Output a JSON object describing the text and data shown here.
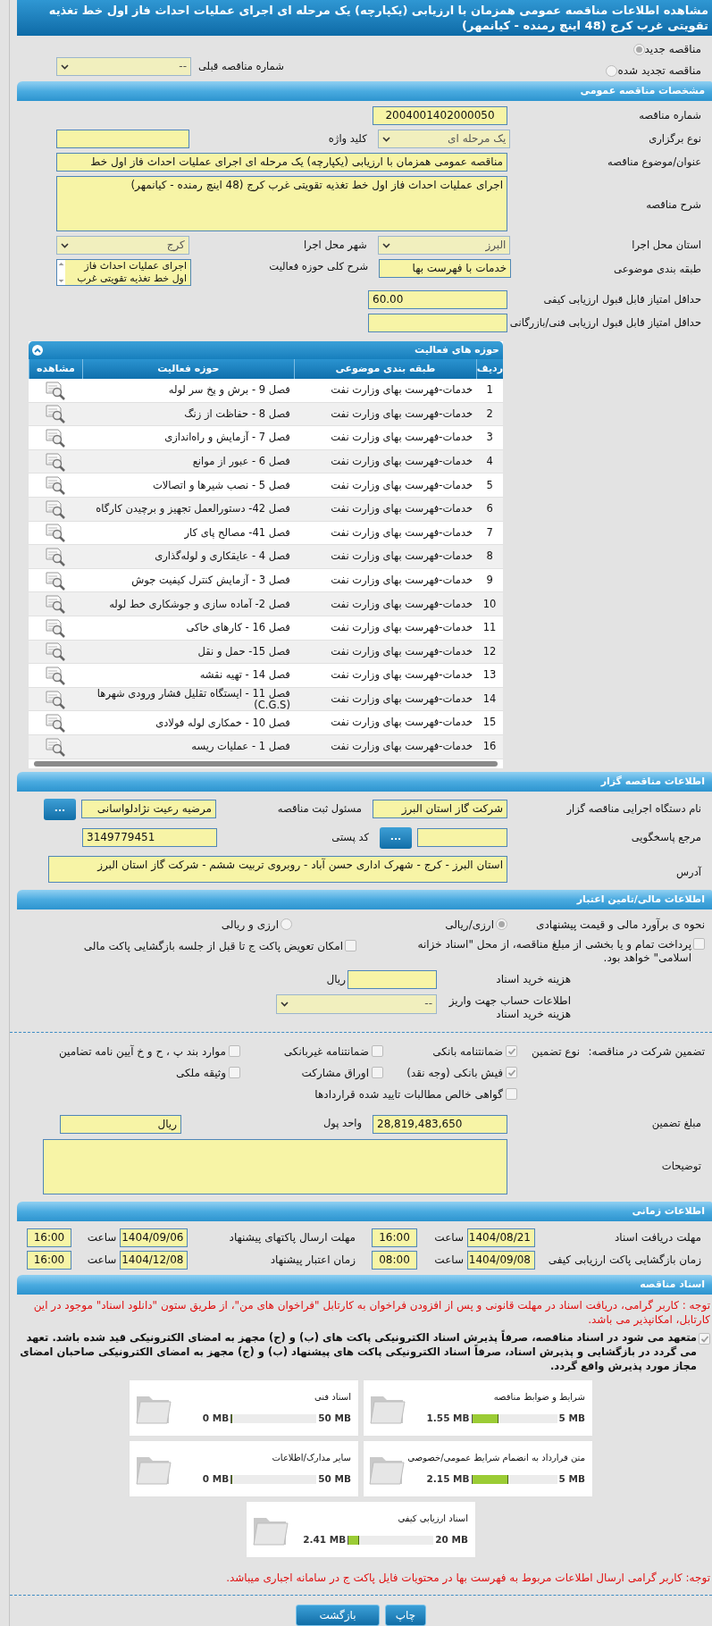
{
  "title": "مشاهده اطلاعات مناقصه عمومی همزمان با ارزیابی (یکپارچه) یک مرحله ای اجرای عملیات احداث فاز اول خط تغذیه تقویتی غرب کرج (48 اینچ رمنده - کیانمهر)",
  "tender_options": [
    {
      "label": "مناقصه جدید",
      "selected": true
    },
    {
      "label": "مناقصه تجدید شده",
      "selected": false
    }
  ],
  "previous_tender": {
    "label": "شماره مناقصه قبلی",
    "value": "--"
  },
  "general": {
    "header": "مشخصات مناقصه عمومی",
    "number": {
      "label": "شماره مناقصه",
      "value": "2004001402000050"
    },
    "holding_type": {
      "label": "نوع برگزاری",
      "value": "یک مرحله ای"
    },
    "keyword": {
      "label": "کلید واژه"
    },
    "subject": {
      "label": "عنوان/موضوع مناقصه",
      "value": "مناقصه عمومی همزمان با ارزیابی (یکپارچه) یک مرحله ای اجرای عملیات احداث فاز اول خط"
    },
    "description": {
      "label": "شرح مناقصه",
      "value": "اجرای عملیات احداث فاز اول خط تغذیه تقویتی غرب کرج (48 اینچ رمنده - کیانمهر)"
    },
    "province": {
      "label": "استان محل اجرا",
      "value": "البرز"
    },
    "city": {
      "label": "شهر محل اجرا",
      "value": "کرج"
    },
    "category": {
      "label": "طبقه بندی موضوعی",
      "value": "خدمات با فهرست بها"
    },
    "activity_summary": {
      "label": "شرح کلی حوزه فعالیت",
      "value": "اجرای عملیات احداث فاز اول خط تغذیه تقویتی غرب"
    },
    "min_quality": {
      "label": "حداقل امتیاز قابل قبول ارزیابی کیفی",
      "value": "60.00"
    },
    "min_technical": {
      "label": "حداقل امتیاز قابل قبول ارزیابی فنی/بازرگانی"
    }
  },
  "activities": {
    "header": "حوزه های فعالیت",
    "columns": [
      "ردیف",
      "طبقه بندی موضوعی",
      "حوزه فعالیت",
      "مشاهده"
    ],
    "rows": [
      [
        "1",
        "خدمات-فهرست بهای وزارت نفت",
        "فصل 9 - برش و پخ سر لوله"
      ],
      [
        "2",
        "خدمات-فهرست بهای وزارت نفت",
        "فصل 8 - حفاظت از زنگ"
      ],
      [
        "3",
        "خدمات-فهرست بهای وزارت نفت",
        "فصل 7 - آزمایش و راه‌اندازی"
      ],
      [
        "4",
        "خدمات-فهرست بهای وزارت نفت",
        "فصل 6 - عبور از موانع"
      ],
      [
        "5",
        "خدمات-فهرست بهای وزارت نفت",
        "فصل 5 - نصب شیرها و اتصالات"
      ],
      [
        "6",
        "خدمات-فهرست بهای وزارت نفت",
        "فصل 42- دستورالعمل تجهیز و برچیدن کارگاه"
      ],
      [
        "7",
        "خدمات-فهرست بهای وزارت نفت",
        "فصل 41- مصالح پای کار"
      ],
      [
        "8",
        "خدمات-فهرست بهای وزارت نفت",
        "فصل 4 - عایقکاری و لوله‌گذاری"
      ],
      [
        "9",
        "خدمات-فهرست بهای وزارت نفت",
        "فصل 3 - آزمایش کنترل کیفیت جوش"
      ],
      [
        "10",
        "خدمات-فهرست بهای وزارت نفت",
        "فصل 2- آماده سازی و جوشکاری خط لوله"
      ],
      [
        "11",
        "خدمات-فهرست بهای وزارت نفت",
        "فصل 16 - کارهای خاکی"
      ],
      [
        "12",
        "خدمات-فهرست بهای وزارت نفت",
        "فصل 15- حمل و نقل"
      ],
      [
        "13",
        "خدمات-فهرست بهای وزارت نفت",
        "فصل 14 - تهیه نقشه"
      ],
      [
        "14",
        "خدمات-فهرست بهای وزارت نفت",
        "فصل 11 - ایستگاه تقلیل فشار ورودی شهرها (C.G.S)"
      ],
      [
        "15",
        "خدمات-فهرست بهای وزارت نفت",
        "فصل 10 - خمکاری لوله فولادی"
      ],
      [
        "16",
        "خدمات-فهرست بهای وزارت نفت",
        "فصل 1 - عملیات ریسه"
      ]
    ]
  },
  "organizer": {
    "header": "اطلاعات مناقصه گزار",
    "org": {
      "label": "نام دستگاه اجرایی مناقصه گزار",
      "value": "شرکت گاز استان البرز"
    },
    "responsible": {
      "label": "مسئول ثبت مناقصه",
      "value": "مرضیه رعیت نژادلواسانی"
    },
    "reference": {
      "label": "مرجع پاسخگویی"
    },
    "postal": {
      "label": "کد پستی",
      "value": "3149779451"
    },
    "address": {
      "label": "آدرس",
      "value": "استان البرز - کرج - شهرک اداری حسن آباد - روبروی تربیت ششم - شرکت گاز استان البرز"
    },
    "more_button": "..."
  },
  "finance": {
    "header": "اطلاعات مالی/تامین اعتبار",
    "estimate_label": "نحوه ی برآورد مالی و قیمت پیشنهادی",
    "estimate_options": [
      {
        "label": "ارزی/ریالی",
        "selected": true
      },
      {
        "label": "ارزی و ریالی",
        "selected": false
      }
    ],
    "treasury": {
      "label": "پرداخت تمام و یا بخشی از مبلغ مناقصه، از محل \"اسناد خزانه اسلامی\" خواهد بود.",
      "checked": false
    },
    "swap": {
      "label": "امکان تعویض پاکت ج تا قبل از جلسه بازگشایی پاکت مالی",
      "checked": false
    },
    "doc_cost": {
      "label": "هزینه خرید اسناد",
      "unit": "ریال"
    },
    "account": {
      "label": "اطلاعات حساب جهت واریز هزینه خرید اسناد",
      "value": "--"
    }
  },
  "guarantee": {
    "label": "تضمین شرکت در مناقصه:",
    "type_label": "نوع تضمین",
    "rows": [
      [
        {
          "label": "ضمانتنامه بانکی",
          "checked": true
        },
        {
          "label": "ضمانتنامه غیربانکی",
          "checked": false
        },
        {
          "label": "موارد بند پ ، ح و خ آیین نامه تضامین",
          "checked": false
        }
      ],
      [
        {
          "label": "فیش بانکی (وجه نقد)",
          "checked": true
        },
        {
          "label": "اوراق مشارکت",
          "checked": false
        },
        {
          "label": "وثیقه ملکی",
          "checked": false
        }
      ],
      [
        {
          "label": "گواهی خالص مطالبات تایید شده قراردادها",
          "checked": false
        }
      ]
    ],
    "amount": {
      "label": "مبلغ تضمین",
      "value": "28,819,483,650"
    },
    "currency": {
      "label": "واحد پول",
      "value": "ریال"
    },
    "notes": {
      "label": "توضیحات"
    }
  },
  "timing": {
    "header": "اطلاعات زمانی",
    "items": [
      {
        "label": "مهلت دریافت اسناد",
        "date": "1404/08/21",
        "time_label": "ساعت",
        "time": "16:00"
      },
      {
        "label": "مهلت ارسال پاکتهای پیشنهاد",
        "date": "1404/09/06",
        "time_label": "ساعت",
        "time": "16:00"
      },
      {
        "label": "زمان بازگشایی پاکت ارزیابی کیفی",
        "date": "1404/09/08",
        "time_label": "ساعت",
        "time": "08:00"
      },
      {
        "label": "زمان اعتبار پیشنهاد",
        "date": "1404/12/08",
        "time_label": "ساعت",
        "time": "16:00"
      }
    ]
  },
  "documents": {
    "header": "اسناد مناقصه",
    "notice": "توجه : کاربر گرامی، دریافت اسناد در مهلت قانونی و پس از افزودن فراخوان به کارتابل \"فراخوان های من\"، از طریق ستون \"دانلود اسناد\" موجود در این کارتابل، امکانپذیر می باشد.",
    "commitment": {
      "checked": true,
      "text": "متعهد می شود در اسناد مناقصه، صرفاً پذیرش اسناد الکترونیکی پاکت های (ب) و (ج) مجهز به امضای الکترونیکی قید شده باشد. تعهد می گردد در بازگشایی و پذیرش اسناد، صرفاً اسناد الکترونیکی پاکت های پیشنهاد (ب) و (ج) مجهز به امضای الکترونیکی صاحبان امضای مجاز مورد پذیرش واقع گردد."
    },
    "files": [
      {
        "name": "شرایط و ضوابط مناقصه",
        "used": "1.55 MB",
        "max": "5 MB",
        "level": 0.31
      },
      {
        "name": "اسناد فنی",
        "used": "0 MB",
        "max": "50 MB",
        "level": 0
      },
      {
        "name": "متن قرارداد به انضمام شرایط عمومی/خصوصی",
        "used": "2.15 MB",
        "max": "5 MB",
        "level": 0.43
      },
      {
        "name": "سایر مدارک/اطلاعات",
        "used": "0 MB",
        "max": "50 MB",
        "level": 0
      },
      {
        "name": "اسناد ارزیابی کیفی",
        "used": "2.41 MB",
        "max": "20 MB",
        "level": 0.12
      }
    ],
    "footer_note": "توجه: کاربر گرامی ارسال اطلاعات مربوط به فهرست بها در محتویات فایل پاکت ج در سامانه اجباری میباشد."
  },
  "actions": [
    "چاپ",
    "بازگشت"
  ]
}
